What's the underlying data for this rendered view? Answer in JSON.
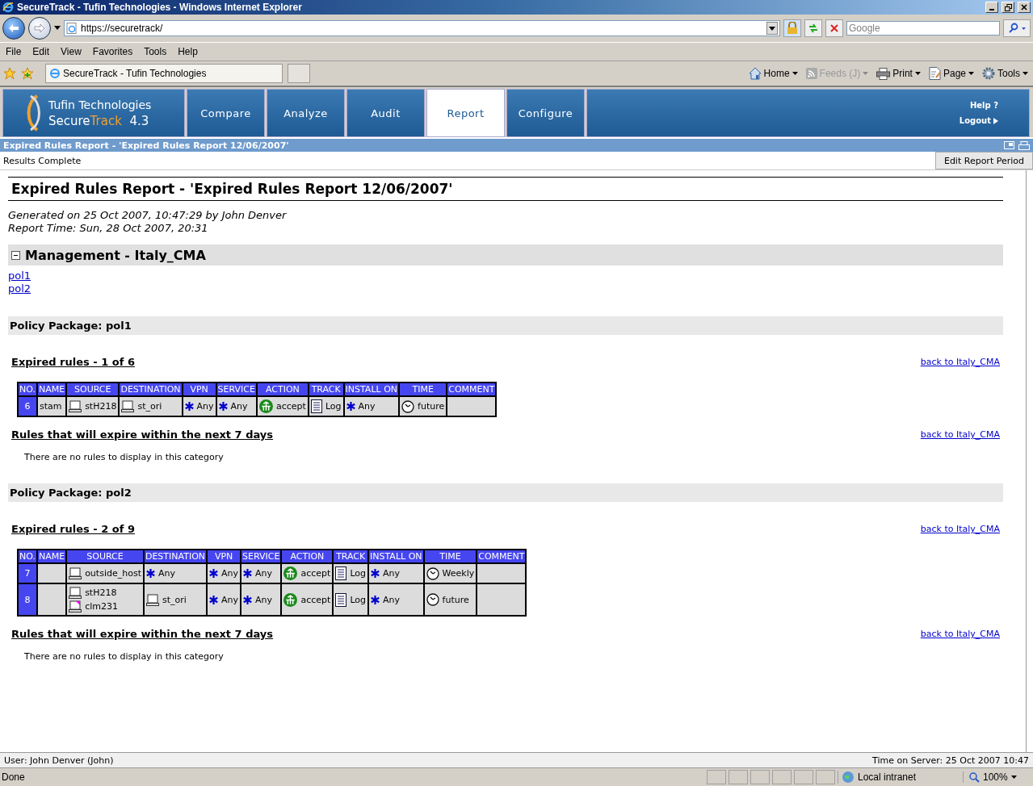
{
  "window": {
    "title": "SecureTrack - Tufin Technologies - Windows Internet Explorer"
  },
  "address_bar": {
    "url": "https://securetrack/"
  },
  "search": {
    "placeholder": "Google"
  },
  "menu": [
    "File",
    "Edit",
    "View",
    "Favorites",
    "Tools",
    "Help"
  ],
  "browser_tab": {
    "label": "SecureTrack - Tufin Technologies"
  },
  "command_bar": [
    {
      "kind": "home",
      "label": "Home",
      "disabled": false
    },
    {
      "kind": "feeds",
      "label": "Feeds (J)",
      "disabled": true
    },
    {
      "kind": "print",
      "label": "Print",
      "disabled": false
    },
    {
      "kind": "page",
      "label": "Page",
      "disabled": false
    },
    {
      "kind": "tools",
      "label": "Tools",
      "disabled": false
    }
  ],
  "app_header": {
    "company": "Tufin Technologies",
    "product_first": "Secure",
    "product_second": "Track",
    "version": "4.3",
    "nav": [
      {
        "label": "Compare",
        "selected": false
      },
      {
        "label": "Analyze",
        "selected": false
      },
      {
        "label": "Audit",
        "selected": false
      },
      {
        "label": "Report",
        "selected": true
      },
      {
        "label": "Configure",
        "selected": false
      }
    ],
    "help": "Help ?",
    "logout": "Logout"
  },
  "report_bar": {
    "title": "Expired Rules Report - 'Expired Rules Report 12/06/2007'",
    "status": "Results Complete",
    "button": "Edit Report Period"
  },
  "report": {
    "title": "Expired Rules Report - 'Expired Rules Report 12/06/2007'",
    "generated": "Generated on 25 Oct 2007, 10:47:29 by John Denver",
    "report_time": "Report Time: Sun, 28 Oct 2007, 20:31",
    "management": {
      "heading": "Management - Italy_CMA",
      "expanded": true
    },
    "links": [
      "pol1",
      "pol2"
    ],
    "packages": [
      {
        "heading": "Policy Package: pol1",
        "sections": [
          {
            "kind": "table",
            "title": "Expired rules - 1 of 6",
            "back_link": "back to Italy_CMA",
            "columns": [
              "NO.",
              "NAME",
              "SOURCE",
              "DESTINATION",
              "VPN",
              "SERVICE",
              "ACTION",
              "TRACK",
              "INSTALL ON",
              "TIME",
              "COMMENT"
            ],
            "rows": [
              {
                "cells": [
                  [
                    {
                      "kind": "text",
                      "text": "6"
                    }
                  ],
                  [
                    {
                      "kind": "text",
                      "text": "stam"
                    }
                  ],
                  [
                    {
                      "kind": "host",
                      "text": "stH218"
                    }
                  ],
                  [
                    {
                      "kind": "host",
                      "text": "st_ori"
                    }
                  ],
                  [
                    {
                      "kind": "any",
                      "text": "Any"
                    }
                  ],
                  [
                    {
                      "kind": "any",
                      "text": "Any"
                    }
                  ],
                  [
                    {
                      "kind": "accept",
                      "text": "accept"
                    }
                  ],
                  [
                    {
                      "kind": "log",
                      "text": "Log"
                    }
                  ],
                  [
                    {
                      "kind": "any",
                      "text": "Any"
                    }
                  ],
                  [
                    {
                      "kind": "clock",
                      "text": "future"
                    }
                  ],
                  []
                ]
              }
            ]
          },
          {
            "kind": "empty",
            "title": "Rules that will expire within the next 7 days",
            "back_link": "back to Italy_CMA",
            "message": "There are no rules to display in this category"
          }
        ]
      },
      {
        "heading": "Policy Package: pol2",
        "sections": [
          {
            "kind": "table",
            "title": "Expired rules - 2 of 9",
            "back_link": "back to Italy_CMA",
            "columns": [
              "NO.",
              "NAME",
              "SOURCE",
              "DESTINATION",
              "VPN",
              "SERVICE",
              "ACTION",
              "TRACK",
              "INSTALL ON",
              "TIME",
              "COMMENT"
            ],
            "rows": [
              {
                "cells": [
                  [
                    {
                      "kind": "text",
                      "text": "7"
                    }
                  ],
                  [],
                  [
                    {
                      "kind": "host",
                      "text": "outside_host"
                    }
                  ],
                  [
                    {
                      "kind": "any",
                      "text": "Any"
                    }
                  ],
                  [
                    {
                      "kind": "any",
                      "text": "Any"
                    }
                  ],
                  [
                    {
                      "kind": "any",
                      "text": "Any"
                    }
                  ],
                  [
                    {
                      "kind": "accept",
                      "text": "accept"
                    }
                  ],
                  [
                    {
                      "kind": "log",
                      "text": "Log"
                    }
                  ],
                  [
                    {
                      "kind": "any",
                      "text": "Any"
                    }
                  ],
                  [
                    {
                      "kind": "clock",
                      "text": "Weekly"
                    }
                  ],
                  []
                ]
              },
              {
                "cells": [
                  [
                    {
                      "kind": "text",
                      "text": "8"
                    }
                  ],
                  [],
                  [
                    {
                      "kind": "host",
                      "text": "stH218"
                    },
                    {
                      "kind": "host-flag",
                      "text": "clm231"
                    }
                  ],
                  [
                    {
                      "kind": "host",
                      "text": "st_ori"
                    }
                  ],
                  [
                    {
                      "kind": "any",
                      "text": "Any"
                    }
                  ],
                  [
                    {
                      "kind": "any",
                      "text": "Any"
                    }
                  ],
                  [
                    {
                      "kind": "accept",
                      "text": "accept"
                    }
                  ],
                  [
                    {
                      "kind": "log",
                      "text": "Log"
                    }
                  ],
                  [
                    {
                      "kind": "any",
                      "text": "Any"
                    }
                  ],
                  [
                    {
                      "kind": "clock",
                      "text": "future"
                    }
                  ],
                  []
                ]
              }
            ]
          },
          {
            "kind": "empty",
            "title": "Rules that will expire within the next 7 days",
            "back_link": "back to Italy_CMA",
            "message": "There are no rules to display in this category"
          }
        ]
      }
    ]
  },
  "footer": {
    "user": "User: John Denver (John)",
    "server_time": "Time on Server: 25 Oct 2007 10:47"
  },
  "status_bar": {
    "text": "Done",
    "zone": "Local intranet",
    "zoom": "100%"
  }
}
